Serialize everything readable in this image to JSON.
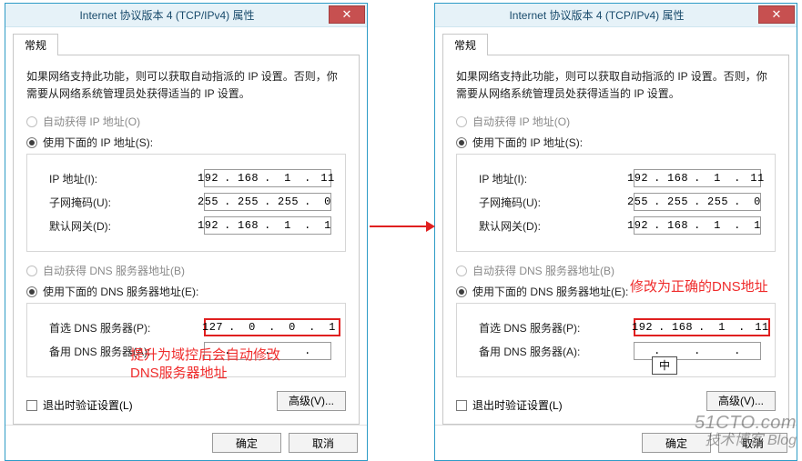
{
  "window_title": "Internet 协议版本 4 (TCP/IPv4) 属性",
  "close_glyph": "✕",
  "tab_general": "常规",
  "desc_text": "如果网络支持此功能，则可以获取自动指派的 IP 设置。否则，你需要从网络系统管理员处获得适当的 IP 设置。",
  "radio_ip_auto": "自动获得 IP 地址(O)",
  "radio_ip_manual": "使用下面的 IP 地址(S):",
  "label_ip": "IP 地址(I):",
  "label_mask": "子网掩码(U):",
  "label_gateway": "默认网关(D):",
  "radio_dns_auto": "自动获得 DNS 服务器地址(B)",
  "radio_dns_manual": "使用下面的 DNS 服务器地址(E):",
  "label_dns_primary": "首选 DNS 服务器(P):",
  "label_dns_alt": "备用 DNS 服务器(A):",
  "check_validate": "退出时验证设置(L)",
  "btn_advanced": "高级(V)...",
  "btn_ok": "确定",
  "btn_cancel": "取消",
  "left": {
    "ip": [
      "192",
      "168",
      "1",
      "11"
    ],
    "mask": [
      "255",
      "255",
      "255",
      "0"
    ],
    "gw": [
      "192",
      "168",
      "1",
      "1"
    ],
    "dns1": [
      "127",
      "0",
      "0",
      "1"
    ],
    "dns2": [
      "",
      "",
      "",
      ""
    ],
    "note": "提升为域控后会自动修改\nDNS服务器地址"
  },
  "right": {
    "ip": [
      "192",
      "168",
      "1",
      "11"
    ],
    "mask": [
      "255",
      "255",
      "255",
      "0"
    ],
    "gw": [
      "192",
      "168",
      "1",
      "1"
    ],
    "dns1": [
      "192",
      "168",
      "1",
      "11"
    ],
    "dns2": [
      "",
      "",
      "",
      ""
    ],
    "note": "修改为正确的DNS地址",
    "ime_text": "中"
  },
  "watermark_big": "51CTO.com",
  "watermark_small": "技术博客 Blog"
}
